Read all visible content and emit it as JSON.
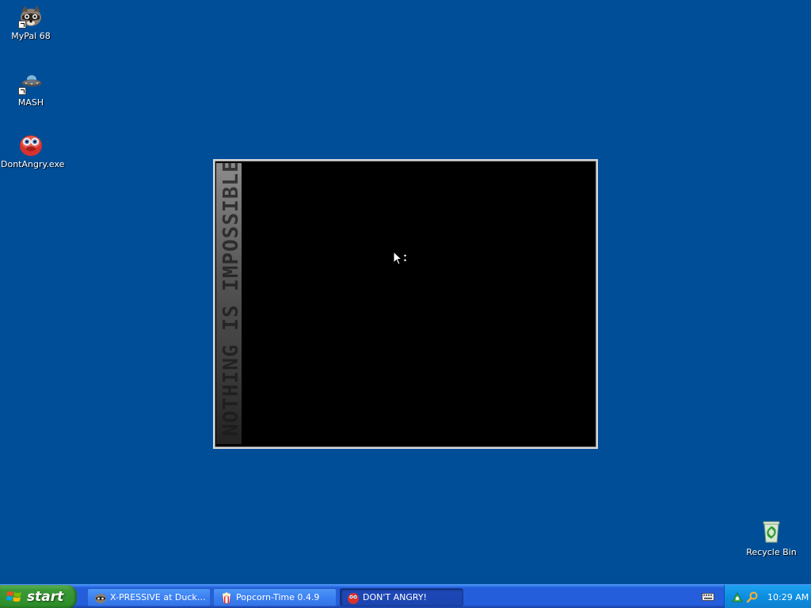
{
  "desktop": {
    "icons": [
      {
        "label": "MyPal 68",
        "icon": "raccoon-icon"
      },
      {
        "label": "MASH",
        "icon": "ufo-icon"
      },
      {
        "label": "DontAngry.exe",
        "icon": "red-bird-icon"
      },
      {
        "label": "Recycle Bin",
        "icon": "recycle-bin-icon"
      }
    ]
  },
  "splash": {
    "strip_text": "NOTHING IS IMPOSSIBLE"
  },
  "taskbar": {
    "start_label": "start",
    "tasks": [
      {
        "label": "X-PRESSIVE at DuckD...",
        "icon": "raccoon-icon",
        "active": false
      },
      {
        "label": "Popcorn-Time 0.4.9",
        "icon": "popcorn-icon",
        "active": false
      },
      {
        "label": "DON'T ANGRY!",
        "icon": "red-bird-icon",
        "active": true
      }
    ],
    "clock": "10:29 AM"
  },
  "colors": {
    "desktop_bg": "#004e98",
    "taskbar_blue": "#245edb",
    "start_green": "#3c9a38",
    "tray_blue": "#0c8ee0"
  }
}
